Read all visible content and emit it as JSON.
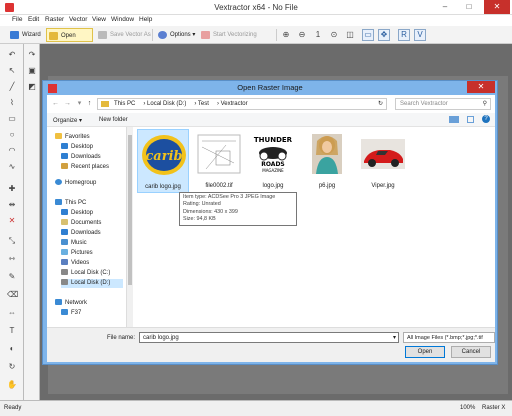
{
  "app": {
    "title": "Vextractor x64 - No File",
    "menu": [
      "File",
      "Edit",
      "Raster",
      "Vector",
      "View",
      "Window",
      "Help"
    ],
    "toolbar": {
      "wizard": "Wizard",
      "open_image": "Open Image",
      "save_vector": "Save Vector As",
      "options": "Options",
      "start_vectorizing": "Start Vectorizing"
    },
    "status_left": "Ready",
    "status_zoom": "100%",
    "status_right": "Raster X"
  },
  "dialog": {
    "title": "Open Raster Image",
    "breadcrumb": [
      "This PC",
      "Local Disk (D:)",
      "Test",
      "Vextractor"
    ],
    "search_placeholder": "Search Vextractor",
    "organize": "Organize",
    "new_folder": "New folder",
    "nav": {
      "favorites": "Favorites",
      "desktop": "Desktop",
      "downloads": "Downloads",
      "recent": "Recent places",
      "homegroup": "Homegroup",
      "this_pc": "This PC",
      "pc_desktop": "Desktop",
      "documents": "Documents",
      "pc_downloads": "Downloads",
      "music": "Music",
      "pictures": "Pictures",
      "videos": "Videos",
      "local_c": "Local Disk (C:)",
      "local_d": "Local Disk (D:)",
      "network": "Network",
      "f37": "F37"
    },
    "files": [
      {
        "name": "carib logo.jpg"
      },
      {
        "name": "file0002.tif"
      },
      {
        "name": "logo.jpg"
      },
      {
        "name": "p6.jpg"
      },
      {
        "name": "Viper.jpg"
      }
    ],
    "thumb_text": {
      "carib": "carib",
      "thunder_1": "THUNDER",
      "thunder_2": "ROADS",
      "thunder_3": "MAGAZINE"
    },
    "tooltip": {
      "type": "Item type: ACDSee Pro 3 JPEG Image",
      "rating": "Rating: Unrated",
      "dimensions": "Dimensions: 430 x 399",
      "size": "Size: 94,8 KB"
    },
    "file_name_label": "File name:",
    "file_name_value": "carib logo.jpg",
    "file_type": "All Image Files (*.bmp;*.jpg;*.tif",
    "open": "Open",
    "cancel": "Cancel"
  }
}
